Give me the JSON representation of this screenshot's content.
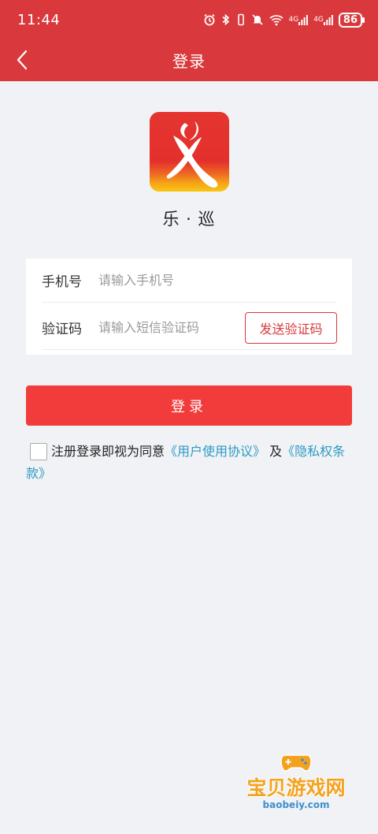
{
  "status_bar": {
    "time": "11:44",
    "signal1": "4G",
    "signal2": "4G",
    "battery": "86"
  },
  "navbar": {
    "title": "登录"
  },
  "app": {
    "name": "乐 · 巡"
  },
  "form": {
    "phone_label": "手机号",
    "phone_placeholder": "请输入手机号",
    "phone_value": "",
    "code_label": "验证码",
    "code_placeholder": "请输入短信验证码",
    "code_value": "",
    "send_code_label": "发送验证码"
  },
  "login_button": {
    "label": "登录"
  },
  "agreement": {
    "checked": false,
    "prefix": "注册登录即视为同意",
    "user_agreement_link": "《用户使用协议》",
    "connector": "及",
    "privacy_link": "《隐私权条款》"
  },
  "watermark": {
    "title": "宝贝游戏网",
    "url": "baobeiy.com"
  },
  "colors": {
    "header": "#d9393d",
    "primary_button": "#f23b3b",
    "link": "#2b9bc4",
    "background": "#f1f2f5"
  }
}
